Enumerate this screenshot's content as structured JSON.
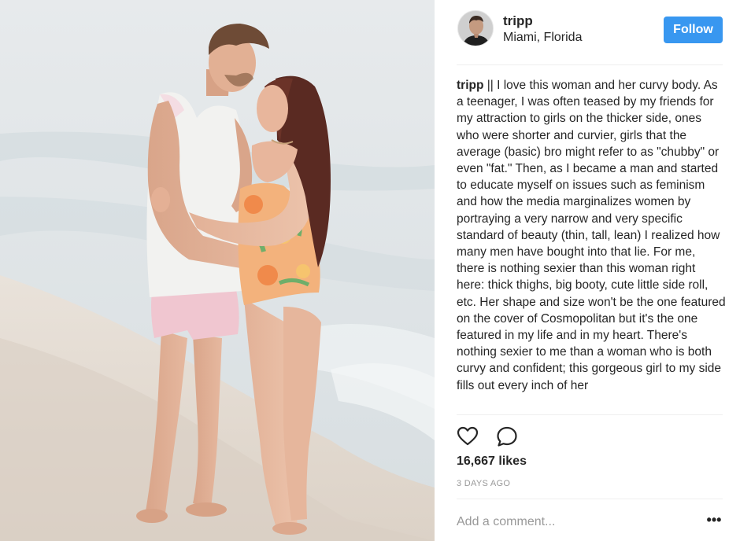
{
  "post": {
    "username": "tripp",
    "location": "Miami, Florida",
    "follow_label": "Follow",
    "caption_user": "tripp",
    "caption_text": " || I love this woman and her curvy body. As a teenager, I was often teased by my friends for my attraction to girls on the thicker side, ones who were shorter and curvier, girls that the average (basic) bro might refer to as \"chubby\" or even \"fat.\" Then, as I became a man and started to educate myself on issues such as feminism and how the media marginalizes women by portraying a very narrow and very specific standard of beauty (thin, tall, lean) I realized how many men have bought into that lie. For me, there is nothing sexier than this woman right here: thick thighs, big booty, cute little side roll, etc. Her shape and size won't be the one featured on the cover of Cosmopolitan but it's the one featured in my life and in my heart. There's nothing sexier to me than a woman who is both curvy and confident; this gorgeous girl to my side fills out every inch of her",
    "likes": "16,667 likes",
    "timestamp": "3 DAYS AGO",
    "comment_placeholder": "Add a comment...",
    "more_label": "•••"
  },
  "icons": {
    "like": "heart-outline-icon",
    "comment": "speech-bubble-icon",
    "more": "ellipsis-icon"
  },
  "colors": {
    "follow_button": "#3897f0",
    "text": "#262626",
    "muted": "#999999"
  }
}
